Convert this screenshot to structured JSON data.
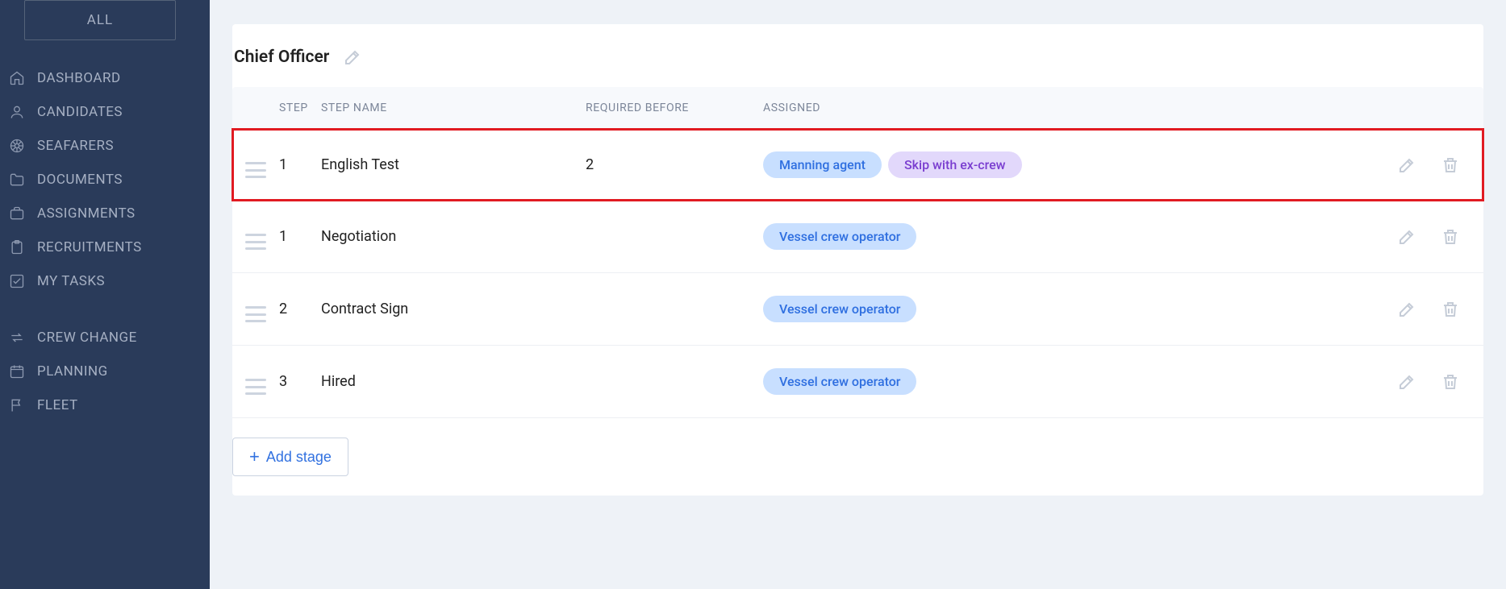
{
  "sidebar": {
    "all_button": "ALL",
    "items_top": [
      {
        "icon": "home",
        "label": "DASHBOARD"
      },
      {
        "icon": "user",
        "label": "CANDIDATES"
      },
      {
        "icon": "wheel",
        "label": "SEAFARERS"
      },
      {
        "icon": "folder",
        "label": "DOCUMENTS"
      },
      {
        "icon": "case",
        "label": "ASSIGNMENTS"
      },
      {
        "icon": "clipboard",
        "label": "RECRUITMENTS"
      },
      {
        "icon": "checkbox",
        "label": "MY TASKS"
      }
    ],
    "items_bottom": [
      {
        "icon": "exchange",
        "label": "CREW CHANGE"
      },
      {
        "icon": "calendar",
        "label": "PLANNING"
      },
      {
        "icon": "flag",
        "label": "FLEET"
      }
    ]
  },
  "page": {
    "title": "Chief Officer",
    "columns": {
      "step": "STEP",
      "name": "STEP NAME",
      "required": "REQUIRED BEFORE",
      "assigned": "ASSIGNED"
    },
    "rows": [
      {
        "step": "1",
        "name": "English Test",
        "required": "2",
        "badges": [
          {
            "text": "Manning agent",
            "style": "blue"
          },
          {
            "text": "Skip with ex-crew",
            "style": "purple"
          }
        ],
        "highlighted": true
      },
      {
        "step": "1",
        "name": "Negotiation",
        "required": "",
        "badges": [
          {
            "text": "Vessel crew operator",
            "style": "blue"
          }
        ],
        "highlighted": false
      },
      {
        "step": "2",
        "name": "Contract Sign",
        "required": "",
        "badges": [
          {
            "text": "Vessel crew operator",
            "style": "blue"
          }
        ],
        "highlighted": false
      },
      {
        "step": "3",
        "name": "Hired",
        "required": "",
        "badges": [
          {
            "text": "Vessel crew operator",
            "style": "blue"
          }
        ],
        "highlighted": false
      }
    ],
    "add_button": "Add stage"
  }
}
